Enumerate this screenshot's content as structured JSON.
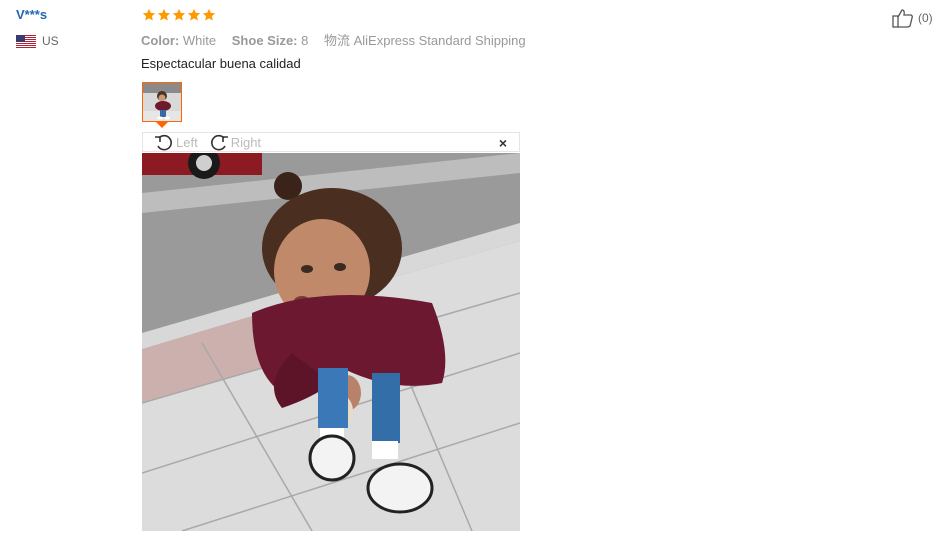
{
  "reviewer": {
    "name": "V***s",
    "country": "US"
  },
  "rating": 5,
  "attributes": {
    "color_label": "Color:",
    "color_value": "White",
    "size_label": "Shoe Size:",
    "size_value": "8",
    "shipping": "物流 AliExpress Standard Shipping"
  },
  "review_text": "Espectacular buena calidad",
  "viewer": {
    "rotate_left": "Left",
    "rotate_right": "Right",
    "close": "×"
  },
  "helpful": {
    "count": "(0)"
  },
  "colors": {
    "star": "#f90",
    "username": "#2167b3",
    "thumb_border": "#f60"
  }
}
